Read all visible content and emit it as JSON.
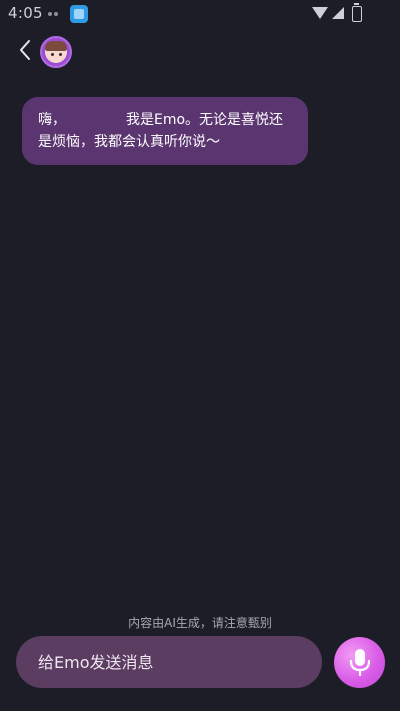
{
  "status_bar": {
    "time": "4:05"
  },
  "header": {
    "back_icon": "chevron-left-icon",
    "avatar_icon": "character-avatar"
  },
  "messages": [
    {
      "sender": "ai",
      "prefix": "嗨，",
      "text": "我是Emo。无论是喜悦还是烦恼，我都会认真听你说～"
    }
  ],
  "disclaimer": "内容由AI生成，请注意甄别",
  "input": {
    "placeholder": "给Emo发送消息",
    "value": ""
  },
  "mic_button": {
    "icon": "microphone-icon"
  },
  "colors": {
    "background": "#1c1d26",
    "bubble": "#5b3570",
    "input_bg": "#5a3d60",
    "accent": "#d95de7"
  }
}
